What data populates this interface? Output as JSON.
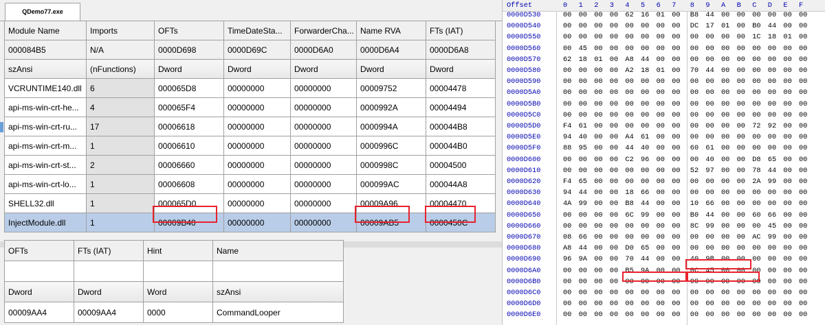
{
  "window": {
    "tab_label": "QDemo77.exe"
  },
  "imports_table": {
    "headers": [
      "Module Name",
      "Imports",
      "OFTs",
      "TimeDateSta...",
      "ForwarderCha...",
      "Name RVA",
      "FTs (IAT)"
    ],
    "meta": [
      "000084B5",
      "N/A",
      "0000D698",
      "0000D69C",
      "0000D6A0",
      "0000D6A4",
      "0000D6A8"
    ],
    "types": [
      "szAnsi",
      "(nFunctions)",
      "Dword",
      "Dword",
      "Dword",
      "Dword",
      "Dword"
    ],
    "rows": [
      [
        "VCRUNTIME140.dll",
        "6",
        "000065D8",
        "00000000",
        "00000000",
        "00009752",
        "00004478"
      ],
      [
        "api-ms-win-crt-he...",
        "4",
        "000065F4",
        "00000000",
        "00000000",
        "0000992A",
        "00004494"
      ],
      [
        "api-ms-win-crt-ru...",
        "17",
        "00006618",
        "00000000",
        "00000000",
        "0000994A",
        "000044B8"
      ],
      [
        "api-ms-win-crt-m...",
        "1",
        "00006610",
        "00000000",
        "00000000",
        "0000996C",
        "000044B0"
      ],
      [
        "api-ms-win-crt-st...",
        "2",
        "00006660",
        "00000000",
        "00000000",
        "0000998C",
        "00004500"
      ],
      [
        "api-ms-win-crt-lo...",
        "1",
        "00006608",
        "00000000",
        "00000000",
        "000099AC",
        "000044A8"
      ],
      [
        "SHELL32.dll",
        "1",
        "000065D0",
        "00000000",
        "00000000",
        "00009A96",
        "00004470"
      ],
      [
        "InjectModule.dll",
        "1",
        "00009B40",
        "00000000",
        "00000000",
        "00009AB5",
        "0000450C"
      ]
    ],
    "selected_row": 7
  },
  "functions_table": {
    "headers": [
      "OFTs",
      "FTs (IAT)",
      "Hint",
      "Name"
    ],
    "types": [
      "Dword",
      "Dword",
      "Word",
      "szAnsi"
    ],
    "rows": [
      [
        "00009AA4",
        "00009AA4",
        "0000",
        "CommandLooper"
      ]
    ]
  },
  "hex_view": {
    "header": {
      "offset": "Offset",
      "columns": [
        "0",
        "1",
        "2",
        "3",
        "4",
        "5",
        "6",
        "7",
        "8",
        "9",
        "A",
        "B",
        "C",
        "D",
        "E",
        "F"
      ]
    },
    "rows": [
      {
        "offset": "0000D530",
        "bytes": [
          "00",
          "00",
          "00",
          "00",
          "62",
          "16",
          "01",
          "00",
          "B8",
          "44",
          "00",
          "00",
          "00",
          "00",
          "00",
          "00"
        ]
      },
      {
        "offset": "0000D540",
        "bytes": [
          "00",
          "00",
          "00",
          "00",
          "00",
          "00",
          "00",
          "00",
          "DC",
          "17",
          "01",
          "00",
          "B0",
          "44",
          "00",
          "00"
        ]
      },
      {
        "offset": "0000D550",
        "bytes": [
          "00",
          "00",
          "00",
          "00",
          "00",
          "00",
          "00",
          "00",
          "00",
          "00",
          "00",
          "00",
          "1C",
          "18",
          "01",
          "00"
        ]
      },
      {
        "offset": "0000D560",
        "bytes": [
          "00",
          "45",
          "00",
          "00",
          "00",
          "00",
          "00",
          "00",
          "00",
          "00",
          "00",
          "00",
          "00",
          "00",
          "00",
          "00"
        ]
      },
      {
        "offset": "0000D570",
        "bytes": [
          "62",
          "18",
          "01",
          "00",
          "A8",
          "44",
          "00",
          "00",
          "00",
          "00",
          "00",
          "00",
          "00",
          "00",
          "00",
          "00"
        ]
      },
      {
        "offset": "0000D580",
        "bytes": [
          "00",
          "00",
          "00",
          "00",
          "A2",
          "18",
          "01",
          "00",
          "70",
          "44",
          "00",
          "00",
          "00",
          "00",
          "00",
          "00"
        ]
      },
      {
        "offset": "0000D590",
        "bytes": [
          "00",
          "00",
          "00",
          "00",
          "00",
          "00",
          "00",
          "00",
          "00",
          "00",
          "00",
          "00",
          "00",
          "00",
          "00",
          "00"
        ]
      },
      {
        "offset": "0000D5A0",
        "bytes": [
          "00",
          "00",
          "00",
          "00",
          "00",
          "00",
          "00",
          "00",
          "00",
          "00",
          "00",
          "00",
          "00",
          "00",
          "00",
          "00"
        ]
      },
      {
        "offset": "0000D5B0",
        "bytes": [
          "00",
          "00",
          "00",
          "00",
          "00",
          "00",
          "00",
          "00",
          "00",
          "00",
          "00",
          "00",
          "00",
          "00",
          "00",
          "00"
        ]
      },
      {
        "offset": "0000D5C0",
        "bytes": [
          "00",
          "00",
          "00",
          "00",
          "00",
          "00",
          "00",
          "00",
          "00",
          "00",
          "00",
          "00",
          "00",
          "00",
          "00",
          "00"
        ]
      },
      {
        "offset": "0000D5D0",
        "bytes": [
          "F4",
          "61",
          "00",
          "00",
          "00",
          "00",
          "00",
          "00",
          "00",
          "00",
          "00",
          "00",
          "72",
          "92",
          "00",
          "00"
        ]
      },
      {
        "offset": "0000D5E0",
        "bytes": [
          "94",
          "40",
          "00",
          "00",
          "A4",
          "61",
          "00",
          "00",
          "00",
          "00",
          "00",
          "00",
          "00",
          "00",
          "00",
          "00"
        ]
      },
      {
        "offset": "0000D5F0",
        "bytes": [
          "88",
          "95",
          "00",
          "00",
          "44",
          "40",
          "00",
          "00",
          "60",
          "61",
          "00",
          "00",
          "00",
          "00",
          "00",
          "00"
        ]
      },
      {
        "offset": "0000D600",
        "bytes": [
          "00",
          "00",
          "00",
          "00",
          "C2",
          "96",
          "00",
          "00",
          "00",
          "40",
          "00",
          "00",
          "D8",
          "65",
          "00",
          "00"
        ]
      },
      {
        "offset": "0000D610",
        "bytes": [
          "00",
          "00",
          "00",
          "00",
          "00",
          "00",
          "00",
          "00",
          "52",
          "97",
          "00",
          "00",
          "78",
          "44",
          "00",
          "00"
        ]
      },
      {
        "offset": "0000D620",
        "bytes": [
          "F4",
          "65",
          "00",
          "00",
          "00",
          "00",
          "00",
          "00",
          "00",
          "00",
          "00",
          "00",
          "2A",
          "99",
          "00",
          "00"
        ]
      },
      {
        "offset": "0000D630",
        "bytes": [
          "94",
          "44",
          "00",
          "00",
          "18",
          "66",
          "00",
          "00",
          "00",
          "00",
          "00",
          "00",
          "00",
          "00",
          "00",
          "00"
        ]
      },
      {
        "offset": "0000D640",
        "bytes": [
          "4A",
          "99",
          "00",
          "00",
          "B8",
          "44",
          "00",
          "00",
          "10",
          "66",
          "00",
          "00",
          "00",
          "00",
          "00",
          "00"
        ]
      },
      {
        "offset": "0000D650",
        "bytes": [
          "00",
          "00",
          "00",
          "00",
          "6C",
          "99",
          "00",
          "00",
          "B0",
          "44",
          "00",
          "00",
          "60",
          "66",
          "00",
          "00"
        ]
      },
      {
        "offset": "0000D660",
        "bytes": [
          "00",
          "00",
          "00",
          "00",
          "00",
          "00",
          "00",
          "00",
          "8C",
          "99",
          "00",
          "00",
          "00",
          "45",
          "00",
          "00"
        ]
      },
      {
        "offset": "0000D670",
        "bytes": [
          "08",
          "66",
          "00",
          "00",
          "00",
          "00",
          "00",
          "00",
          "00",
          "00",
          "00",
          "00",
          "AC",
          "99",
          "00",
          "00"
        ]
      },
      {
        "offset": "0000D680",
        "bytes": [
          "A8",
          "44",
          "00",
          "00",
          "D0",
          "65",
          "00",
          "00",
          "00",
          "00",
          "00",
          "00",
          "00",
          "00",
          "00",
          "00"
        ]
      },
      {
        "offset": "0000D690",
        "bytes": [
          "96",
          "9A",
          "00",
          "00",
          "70",
          "44",
          "00",
          "00",
          "40",
          "9B",
          "00",
          "00",
          "00",
          "00",
          "00",
          "00"
        ]
      },
      {
        "offset": "0000D6A0",
        "bytes": [
          "00",
          "00",
          "00",
          "00",
          "B5",
          "9A",
          "00",
          "00",
          "0C",
          "45",
          "00",
          "00",
          "00",
          "00",
          "00",
          "00"
        ]
      },
      {
        "offset": "0000D6B0",
        "bytes": [
          "00",
          "00",
          "00",
          "00",
          "00",
          "00",
          "00",
          "00",
          "00",
          "00",
          "00",
          "00",
          "00",
          "00",
          "00",
          "00"
        ]
      },
      {
        "offset": "0000D6C0",
        "bytes": [
          "00",
          "00",
          "00",
          "00",
          "00",
          "00",
          "00",
          "00",
          "00",
          "00",
          "00",
          "00",
          "00",
          "00",
          "00",
          "00"
        ]
      },
      {
        "offset": "0000D6D0",
        "bytes": [
          "00",
          "00",
          "00",
          "00",
          "00",
          "00",
          "00",
          "00",
          "00",
          "00",
          "00",
          "00",
          "00",
          "00",
          "00",
          "00"
        ]
      },
      {
        "offset": "0000D6E0",
        "bytes": [
          "00",
          "00",
          "00",
          "00",
          "00",
          "00",
          "00",
          "00",
          "00",
          "00",
          "00",
          "00",
          "00",
          "00",
          "00",
          "00"
        ]
      }
    ]
  },
  "colors": {
    "selection": "#b9cde8",
    "highlight_box": "#e8212b",
    "offset_text": "#0000b0"
  }
}
